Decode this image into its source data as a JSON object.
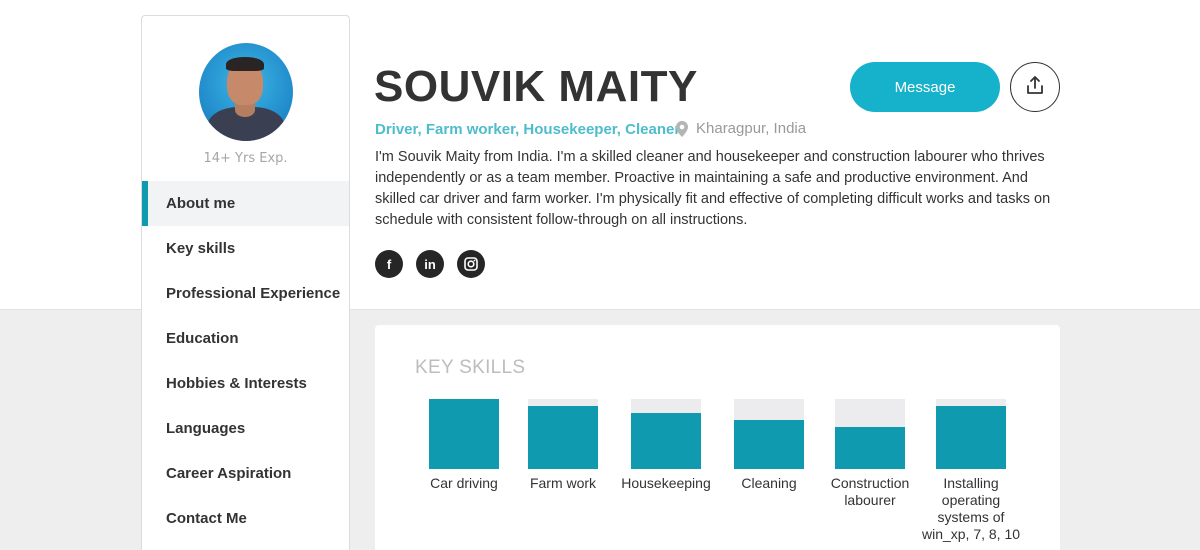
{
  "profile": {
    "name": "SOUVIK MAITY",
    "experience": "14+ Yrs Exp.",
    "roles": "Driver, Farm worker, Housekeeper, Cleaner",
    "location": "Kharagpur, India",
    "bio": "I'm Souvik Maity from India. I'm a skilled cleaner and housekeeper and construction labourer who thrives independently or as a team member. Proactive in maintaining a safe and productive environment. And skilled car driver and farm worker. I'm physically fit and effective of completing difficult works and tasks on schedule with consistent follow-through on all instructions."
  },
  "actions": {
    "message_label": "Message",
    "share_icon": "share-icon"
  },
  "social": [
    {
      "icon": "facebook-icon",
      "glyph": "f"
    },
    {
      "icon": "linkedin-icon",
      "glyph": "in"
    },
    {
      "icon": "instagram-icon",
      "glyph": ""
    }
  ],
  "sidebar": {
    "items": [
      {
        "label": "About me",
        "active": true
      },
      {
        "label": "Key skills",
        "active": false
      },
      {
        "label": "Professional Experience",
        "active": false
      },
      {
        "label": "Education",
        "active": false
      },
      {
        "label": "Hobbies & Interests",
        "active": false
      },
      {
        "label": "Languages",
        "active": false
      },
      {
        "label": "Career Aspiration",
        "active": false
      },
      {
        "label": "Contact Me",
        "active": false
      }
    ]
  },
  "key_skills": {
    "title": "KEY SKILLS",
    "items": [
      {
        "label": "Car driving",
        "level": 1.0
      },
      {
        "label": "Farm work",
        "level": 0.9
      },
      {
        "label": "Housekeeping",
        "level": 0.8
      },
      {
        "label": "Cleaning",
        "level": 0.7
      },
      {
        "label": "Construction labourer",
        "level": 0.6
      },
      {
        "label": "Installing operating systems of win_xp, 7, 8, 10",
        "level": 0.9
      }
    ]
  },
  "colors": {
    "accent": "#16b1ca",
    "skill_fill": "#0f9aaf",
    "role_text": "#4dbdcc"
  }
}
